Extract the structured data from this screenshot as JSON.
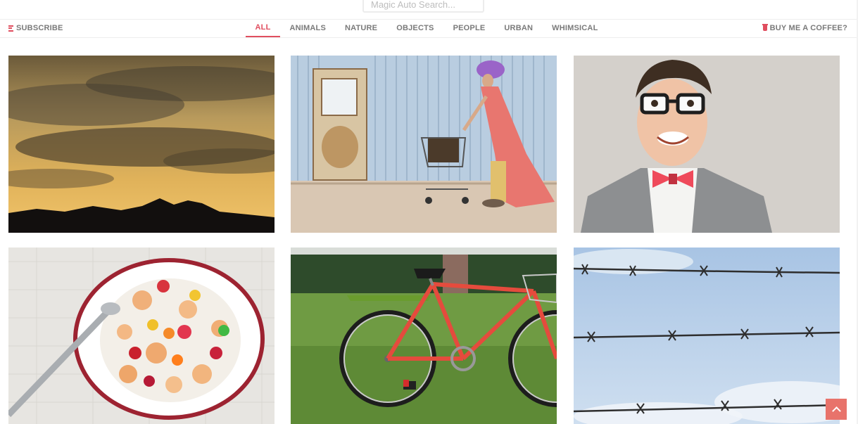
{
  "search": {
    "placeholder": "Magic Auto Search..."
  },
  "nav": {
    "subscribe_label": "SUBSCRIBE",
    "coffee_label": "BUY ME A COFFEE?",
    "tabs": [
      {
        "label": "ALL",
        "active": true
      },
      {
        "label": "ANIMALS",
        "active": false
      },
      {
        "label": "NATURE",
        "active": false
      },
      {
        "label": "OBJECTS",
        "active": false
      },
      {
        "label": "PEOPLE",
        "active": false
      },
      {
        "label": "URBAN",
        "active": false
      },
      {
        "label": "WHIMSICAL",
        "active": false
      }
    ]
  },
  "colors": {
    "accent": "#e04e5f",
    "nav_text": "#7a7a7a",
    "scroll_button": "#e8736b"
  },
  "icons": {
    "subscribe": "list-icon",
    "coffee": "coffee-cup-icon",
    "scroll_top": "chevron-up-icon"
  }
}
